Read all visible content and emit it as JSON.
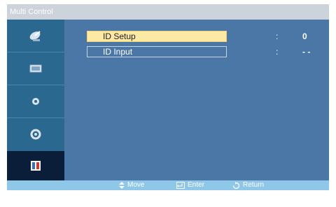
{
  "window": {
    "title": "Multi Control"
  },
  "sidebar": {
    "items": [
      {
        "icon": "satellite-dish-icon",
        "active": false
      },
      {
        "icon": "picture-icon",
        "active": false
      },
      {
        "icon": "sound-icon",
        "active": false
      },
      {
        "icon": "setup-gear-icon",
        "active": false
      },
      {
        "icon": "multi-control-icon",
        "active": true
      }
    ]
  },
  "menu": {
    "rows": [
      {
        "label": "ID Setup",
        "separator": ":",
        "value": "0",
        "selected": true
      },
      {
        "label": "ID Input",
        "separator": ":",
        "value": "- -",
        "selected": false
      }
    ]
  },
  "footer": {
    "move": "Move",
    "enter": "Enter",
    "return": "Return"
  },
  "colors": {
    "panel": "#4a77a6",
    "sidebar": "#2a6890",
    "sidebar_active": "#0a1e3a",
    "highlight": "#fde9a6",
    "footer": "#8ec7e8"
  }
}
